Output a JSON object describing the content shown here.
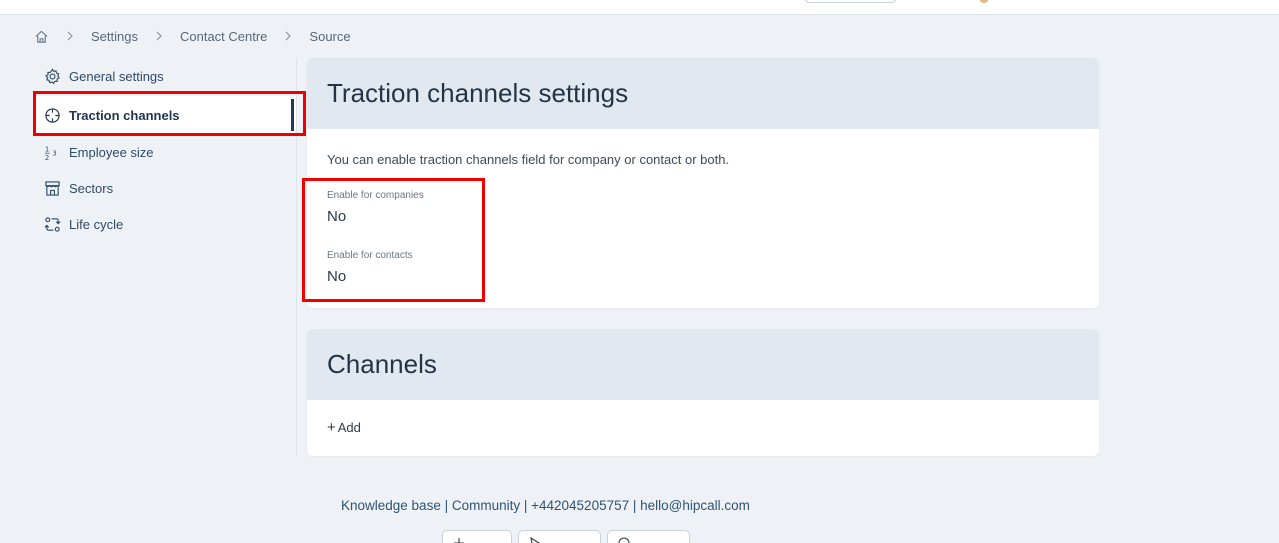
{
  "breadcrumb": {
    "items": [
      "Settings",
      "Contact Centre",
      "Source"
    ]
  },
  "sidebar": {
    "items": [
      {
        "label": "General settings",
        "icon": "gear-icon"
      },
      {
        "label": "Traction channels",
        "icon": "crosshair-icon",
        "active": true
      },
      {
        "label": "Employee size",
        "icon": "numbers-icon"
      },
      {
        "label": "Sectors",
        "icon": "storefront-icon"
      },
      {
        "label": "Life cycle",
        "icon": "cycle-icon"
      }
    ]
  },
  "traction_settings": {
    "title": "Traction channels settings",
    "description": "You can enable traction channels field for company or contact or both.",
    "companies_label": "Enable for companies",
    "companies_value": "No",
    "contacts_label": "Enable for contacts",
    "contacts_value": "No"
  },
  "channels": {
    "title": "Channels",
    "add_label": "Add"
  },
  "footer": {
    "knowledge_base": "Knowledge base",
    "community": "Community",
    "phone": "+442045205757",
    "email": "hello@hipcall.com",
    "separator": " | "
  },
  "colors": {
    "highlight": "#ee0000",
    "active_indicator": "#1d3a5c",
    "card_header": "#e1e8f0",
    "page_background": "#eef2f7"
  }
}
